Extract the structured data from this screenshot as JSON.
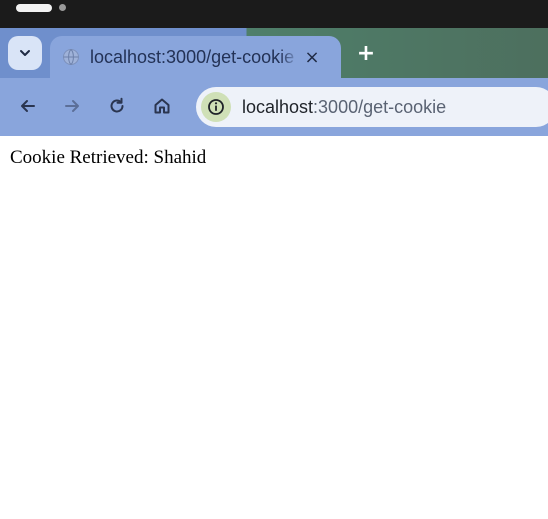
{
  "tab": {
    "title": "localhost:3000/get-cookie",
    "close_label": "×"
  },
  "new_tab_label": "+",
  "address_bar": {
    "host": "localhost",
    "path": ":3000/get-cookie"
  },
  "page": {
    "message": "Cookie Retrieved: Shahid"
  },
  "icons": {
    "tab_search": "chevron-down-icon",
    "favicon": "globe-icon",
    "back": "arrow-left-icon",
    "forward": "arrow-right-icon",
    "reload": "reload-icon",
    "home": "home-icon",
    "site_info": "info-icon"
  },
  "colors": {
    "system_bar": "#1b1b1b",
    "tabstrip_blue": "#6f8fcc",
    "tabstrip_green": "#4f7f6a",
    "active_tab": "#89a5dc",
    "omnibox": "#eef2f9",
    "site_info_badge": "#cfe0b7"
  }
}
